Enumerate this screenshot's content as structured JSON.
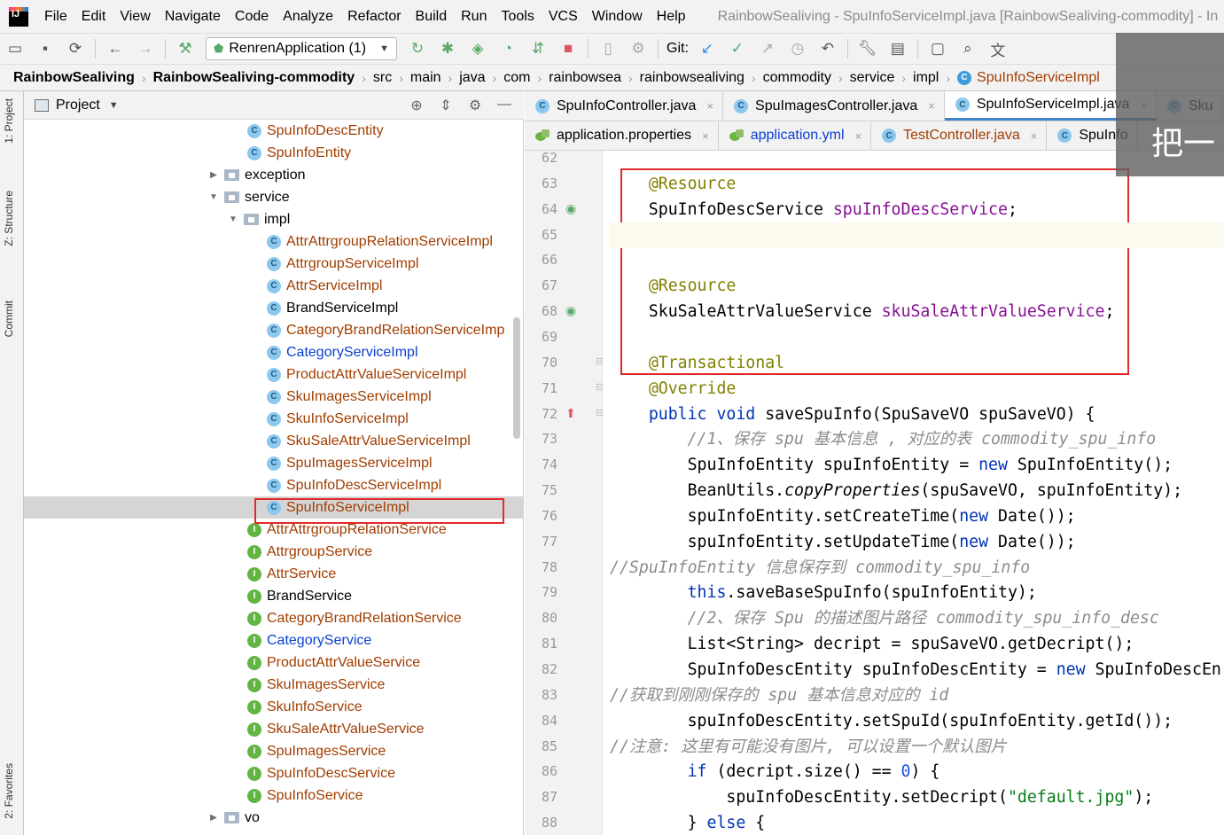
{
  "window_title": "RainbowSealiving - SpuInfoServiceImpl.java [RainbowSealiving-commodity] - In",
  "menu": [
    "File",
    "Edit",
    "View",
    "Navigate",
    "Code",
    "Analyze",
    "Refactor",
    "Build",
    "Run",
    "Tools",
    "VCS",
    "Window",
    "Help"
  ],
  "toolbar": {
    "run_config": "RenrenApplication (1)",
    "git_label": "Git:"
  },
  "breadcrumb": [
    "RainbowSealiving",
    "RainbowSealiving-commodity",
    "src",
    "main",
    "java",
    "com",
    "rainbowsea",
    "rainbowsealiving",
    "commodity",
    "service",
    "impl",
    "SpuInfoServiceImpl"
  ],
  "side_tabs": {
    "project": "1: Project",
    "structure": "Z: Structure",
    "commit": "Commit",
    "favorites": "2: Favorites"
  },
  "project_panel": {
    "title": "Project"
  },
  "tree": [
    {
      "label": "SpuInfoDescEntity",
      "kind": "class",
      "color": "brown"
    },
    {
      "label": "SpuInfoEntity",
      "kind": "class",
      "color": "brown"
    },
    {
      "label": "exception",
      "kind": "folder",
      "color": "black",
      "toggle": "▶"
    },
    {
      "label": "service",
      "kind": "folder",
      "color": "black",
      "toggle": "▼"
    },
    {
      "label": "impl",
      "kind": "folder",
      "color": "black",
      "toggle": "▼"
    },
    {
      "label": "AttrAttrgroupRelationServiceImpl",
      "kind": "class",
      "color": "brown"
    },
    {
      "label": "AttrgroupServiceImpl",
      "kind": "class",
      "color": "brown"
    },
    {
      "label": "AttrServiceImpl",
      "kind": "class",
      "color": "brown"
    },
    {
      "label": "BrandServiceImpl",
      "kind": "class",
      "color": "black"
    },
    {
      "label": "CategoryBrandRelationServiceImp",
      "kind": "class",
      "color": "brown"
    },
    {
      "label": "CategoryServiceImpl",
      "kind": "class",
      "color": "blue"
    },
    {
      "label": "ProductAttrValueServiceImpl",
      "kind": "class",
      "color": "brown"
    },
    {
      "label": "SkuImagesServiceImpl",
      "kind": "class",
      "color": "brown"
    },
    {
      "label": "SkuInfoServiceImpl",
      "kind": "class",
      "color": "brown"
    },
    {
      "label": "SkuSaleAttrValueServiceImpl",
      "kind": "class",
      "color": "brown"
    },
    {
      "label": "SpuImagesServiceImpl",
      "kind": "class",
      "color": "brown"
    },
    {
      "label": "SpuInfoDescServiceImpl",
      "kind": "class",
      "color": "brown"
    },
    {
      "label": "SpuInfoServiceImpl",
      "kind": "class",
      "color": "brown",
      "selected": true
    },
    {
      "label": "AttrAttrgroupRelationService",
      "kind": "interface",
      "color": "brown"
    },
    {
      "label": "AttrgroupService",
      "kind": "interface",
      "color": "brown"
    },
    {
      "label": "AttrService",
      "kind": "interface",
      "color": "brown"
    },
    {
      "label": "BrandService",
      "kind": "interface",
      "color": "black"
    },
    {
      "label": "CategoryBrandRelationService",
      "kind": "interface",
      "color": "brown"
    },
    {
      "label": "CategoryService",
      "kind": "interface",
      "color": "blue"
    },
    {
      "label": "ProductAttrValueService",
      "kind": "interface",
      "color": "brown"
    },
    {
      "label": "SkuImagesService",
      "kind": "interface",
      "color": "brown"
    },
    {
      "label": "SkuInfoService",
      "kind": "interface",
      "color": "brown"
    },
    {
      "label": "SkuSaleAttrValueService",
      "kind": "interface",
      "color": "brown"
    },
    {
      "label": "SpuImagesService",
      "kind": "interface",
      "color": "brown"
    },
    {
      "label": "SpuInfoDescService",
      "kind": "interface",
      "color": "brown"
    },
    {
      "label": "SpuInfoService",
      "kind": "interface",
      "color": "brown"
    },
    {
      "label": "vo",
      "kind": "folder",
      "color": "black",
      "toggle": "▶"
    }
  ],
  "tabs_row1": [
    {
      "label": "SpuInfoController.java",
      "icon": "class-icon",
      "active": false,
      "close": "×"
    },
    {
      "label": "SpuImagesController.java",
      "icon": "class-icon",
      "active": false,
      "close": "×"
    },
    {
      "label": "SpuInfoServiceImpl.java",
      "icon": "class-icon",
      "active": true,
      "close": "×"
    },
    {
      "label": "Sku",
      "icon": "class-icon",
      "active": false,
      "close": ""
    }
  ],
  "tabs_row2": [
    {
      "label": "application.properties",
      "icon": "spring-icon",
      "active": false,
      "color": "black",
      "close": "×"
    },
    {
      "label": "application.yml",
      "icon": "yaml-icon",
      "active": false,
      "color": "blue",
      "close": "×"
    },
    {
      "label": "TestController.java",
      "icon": "class-icon",
      "active": false,
      "color": "brown",
      "close": "×"
    },
    {
      "label": "SpuInfo",
      "icon": "class-icon",
      "active": false,
      "color": "black",
      "close": ""
    }
  ],
  "code_lines": [
    {
      "n": 62,
      "segs": []
    },
    {
      "n": 63,
      "segs": [
        {
          "t": "    "
        },
        {
          "t": "@Resource",
          "c": "ann"
        }
      ]
    },
    {
      "n": 64,
      "gut": "bean",
      "segs": [
        {
          "t": "    SpuInfoDescService "
        },
        {
          "t": "spuInfoDescService",
          "c": "fld"
        },
        {
          "t": ";"
        }
      ]
    },
    {
      "n": 65,
      "cur": true,
      "segs": []
    },
    {
      "n": 66,
      "segs": []
    },
    {
      "n": 67,
      "segs": [
        {
          "t": "    "
        },
        {
          "t": "@Resource",
          "c": "ann"
        }
      ]
    },
    {
      "n": 68,
      "gut": "bean",
      "segs": [
        {
          "t": "    SkuSaleAttrValueService "
        },
        {
          "t": "skuSaleAttrValueService",
          "c": "fld"
        },
        {
          "t": ";"
        }
      ]
    },
    {
      "n": 69,
      "segs": []
    },
    {
      "n": 70,
      "fold": true,
      "segs": [
        {
          "t": "    "
        },
        {
          "t": "@Transactional",
          "c": "ann"
        }
      ]
    },
    {
      "n": 71,
      "fold": true,
      "segs": [
        {
          "t": "    "
        },
        {
          "t": "@Override",
          "c": "ann"
        }
      ]
    },
    {
      "n": 72,
      "gut": "impl",
      "fold": true,
      "segs": [
        {
          "t": "    "
        },
        {
          "t": "public void ",
          "c": "kw"
        },
        {
          "t": "saveSpuInfo(SpuSaveVO spuSaveVO) {"
        }
      ]
    },
    {
      "n": 73,
      "segs": [
        {
          "t": "        "
        },
        {
          "t": "//1、保存 spu 基本信息 , 对应的表 commodity_spu_info",
          "c": "cm"
        }
      ]
    },
    {
      "n": 74,
      "segs": [
        {
          "t": "        SpuInfoEntity spuInfoEntity = "
        },
        {
          "t": "new ",
          "c": "kw"
        },
        {
          "t": "SpuInfoEntity();"
        }
      ]
    },
    {
      "n": 75,
      "segs": [
        {
          "t": "        BeanUtils."
        },
        {
          "t": "copyProperties",
          "c": "it"
        },
        {
          "t": "(spuSaveVO, spuInfoEntity);"
        }
      ]
    },
    {
      "n": 76,
      "segs": [
        {
          "t": "        spuInfoEntity.setCreateTime("
        },
        {
          "t": "new ",
          "c": "kw"
        },
        {
          "t": "Date());"
        }
      ]
    },
    {
      "n": 77,
      "segs": [
        {
          "t": "        spuInfoEntity.setUpdateTime("
        },
        {
          "t": "new ",
          "c": "kw"
        },
        {
          "t": "Date());"
        }
      ]
    },
    {
      "n": 78,
      "segs": [
        {
          "t": "//SpuInfoEntity 信息保存到 commodity_spu_info",
          "c": "cm"
        }
      ]
    },
    {
      "n": 79,
      "segs": [
        {
          "t": "        "
        },
        {
          "t": "this",
          "c": "kw"
        },
        {
          "t": ".saveBaseSpuInfo(spuInfoEntity);"
        }
      ]
    },
    {
      "n": 80,
      "segs": [
        {
          "t": "        "
        },
        {
          "t": "//2、保存 Spu 的描述图片路径 commodity_spu_info_desc",
          "c": "cm"
        }
      ]
    },
    {
      "n": 81,
      "segs": [
        {
          "t": "        List<String> decript = spuSaveVO.getDecript();"
        }
      ]
    },
    {
      "n": 82,
      "segs": [
        {
          "t": "        SpuInfoDescEntity spuInfoDescEntity = "
        },
        {
          "t": "new ",
          "c": "kw"
        },
        {
          "t": "SpuInfoDescEn"
        }
      ]
    },
    {
      "n": 83,
      "segs": [
        {
          "t": "//获取到刚刚保存的 spu 基本信息对应的 id",
          "c": "cm"
        }
      ]
    },
    {
      "n": 84,
      "segs": [
        {
          "t": "        spuInfoDescEntity.setSpuId(spuInfoEntity.getId());"
        }
      ]
    },
    {
      "n": 85,
      "segs": [
        {
          "t": "//注意: 这里有可能没有图片, 可以设置一个默认图片",
          "c": "cm"
        }
      ]
    },
    {
      "n": 86,
      "segs": [
        {
          "t": "        "
        },
        {
          "t": "if ",
          "c": "kw"
        },
        {
          "t": "(decript.size() == "
        },
        {
          "t": "0",
          "c": "num"
        },
        {
          "t": ") {"
        }
      ]
    },
    {
      "n": 87,
      "segs": [
        {
          "t": "            spuInfoDescEntity.setDecript("
        },
        {
          "t": "\"default.jpg\"",
          "c": "str"
        },
        {
          "t": ");"
        }
      ]
    },
    {
      "n": 88,
      "segs": [
        {
          "t": "        } "
        },
        {
          "t": "else ",
          "c": "kw"
        },
        {
          "t": "{"
        }
      ]
    }
  ],
  "overlay_text": "把一"
}
